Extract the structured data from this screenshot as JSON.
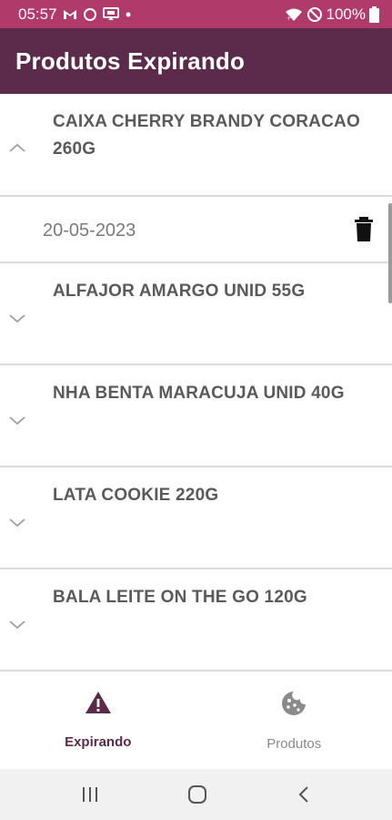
{
  "status_bar": {
    "time": "05:57",
    "battery": "100%",
    "background": "#b03a6a",
    "left_icons": [
      "gmail-icon",
      "circle-icon",
      "cast-icon",
      "dot-icon"
    ],
    "right_icons": [
      "wifi-icon",
      "do-not-disturb-icon",
      "battery-icon"
    ]
  },
  "app_bar": {
    "title": "Produtos Expirando",
    "background": "#5c2a4a"
  },
  "list": {
    "items": [
      {
        "name": "CAIXA CHERRY BRANDY CORACAO 260G",
        "expanded": true,
        "detail": {
          "date": "20-05-2023",
          "action_icon": "trash-icon"
        }
      },
      {
        "name": "ALFAJOR AMARGO UNID 55G",
        "expanded": false
      },
      {
        "name": "NHA BENTA MARACUJA UNID 40G",
        "expanded": false
      },
      {
        "name": "LATA COOKIE 220G",
        "expanded": false
      },
      {
        "name": "BALA LEITE ON THE GO 120G",
        "expanded": false
      }
    ]
  },
  "bottom_nav": {
    "items": [
      {
        "label": "Expirando",
        "icon": "warning-icon",
        "active": true
      },
      {
        "label": "Produtos",
        "icon": "cookie-icon",
        "active": false
      }
    ],
    "active_color": "#5c2a4a",
    "inactive_color": "#8a8a8a"
  },
  "system_nav": {
    "buttons": [
      "recents-icon",
      "home-icon",
      "back-icon"
    ]
  }
}
